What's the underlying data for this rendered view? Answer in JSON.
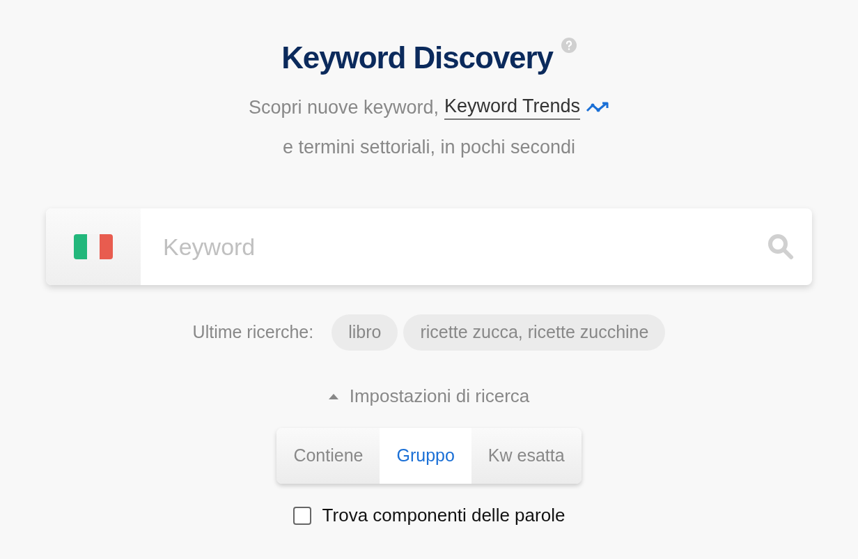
{
  "title": "Keyword Discovery",
  "subtitle": {
    "text": "Scopri nuove keyword,",
    "link": "Keyword Trends",
    "line2": "e termini settoriali, in pochi secondi"
  },
  "search": {
    "placeholder": "Keyword"
  },
  "recent": {
    "label": "Ultime ricerche:",
    "items": [
      "libro",
      "ricette zucca, ricette zucchine"
    ]
  },
  "settings": {
    "label": "Impostazioni di ricerca",
    "expanded": true
  },
  "modes": [
    {
      "label": "Contiene",
      "selected": false
    },
    {
      "label": "Gruppo",
      "selected": true
    },
    {
      "label": "Kw esatta",
      "selected": false
    }
  ],
  "option": {
    "label": "Trova componenti delle parole",
    "checked": false
  }
}
